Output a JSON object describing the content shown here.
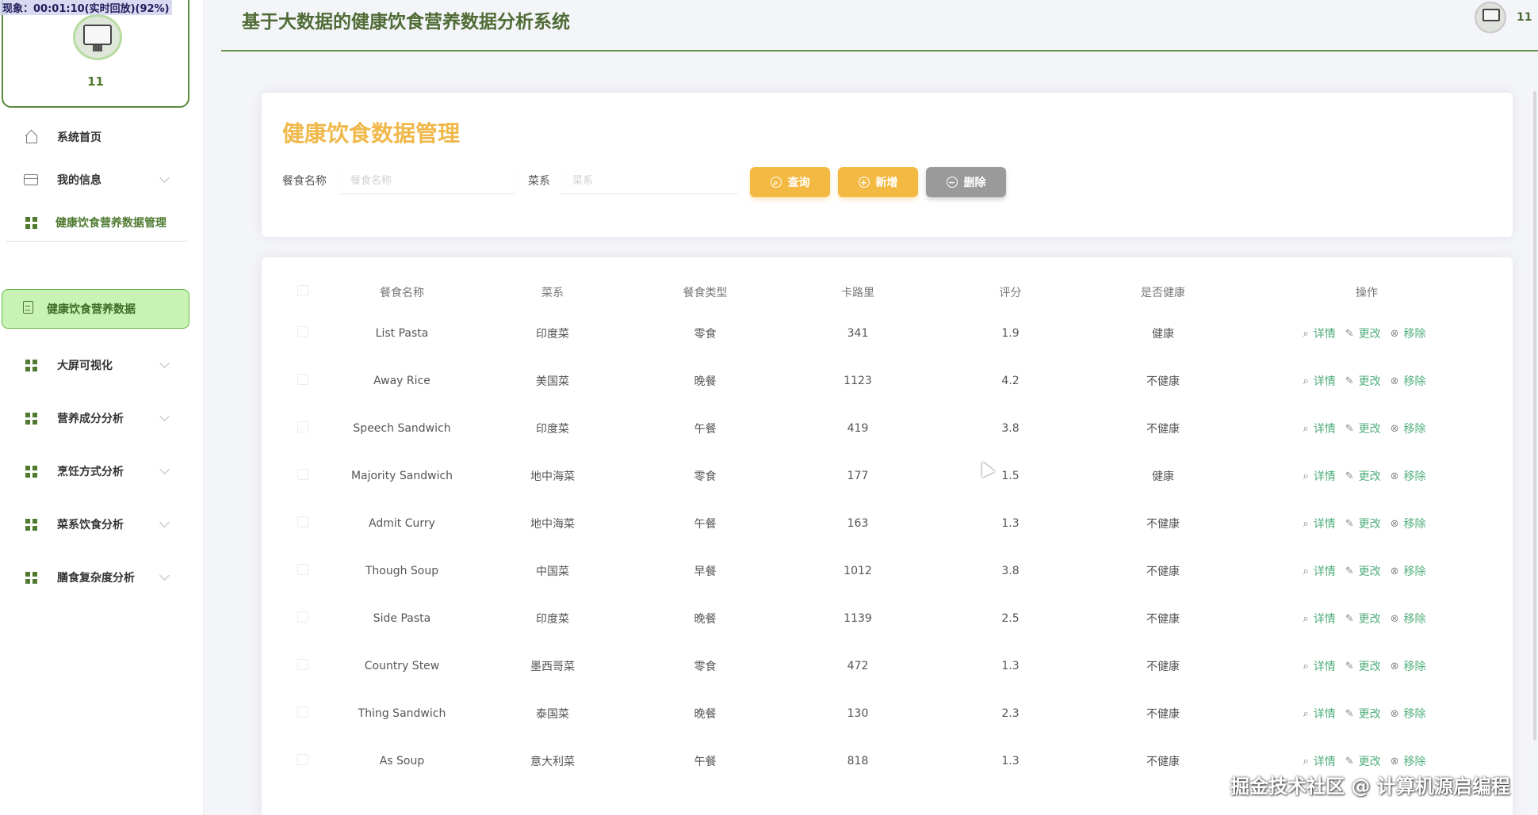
{
  "overlay": "现象：00:01:10(实时回放)(92%)",
  "sidebar": {
    "user_name": "11",
    "menu": [
      {
        "label": "系统首页",
        "icon": "home-icon"
      },
      {
        "label": "我的信息",
        "icon": "card-icon"
      },
      {
        "label": "健康饮食营养数据管理",
        "icon": "grid-icon"
      },
      {
        "label": "健康饮食营养数据",
        "icon": "doc-icon"
      },
      {
        "label": "大屏可视化",
        "icon": "grid-icon"
      },
      {
        "label": "营养成分分析",
        "icon": "grid-icon"
      },
      {
        "label": "烹饪方式分析",
        "icon": "grid-icon"
      },
      {
        "label": "菜系饮食分析",
        "icon": "grid-icon"
      },
      {
        "label": "膳食复杂度分析",
        "icon": "grid-icon"
      }
    ]
  },
  "header": {
    "title": "基于大数据的健康饮食营养数据分析系统",
    "user": "11"
  },
  "search": {
    "title": "健康饮食数据管理",
    "name_label": "餐食名称",
    "name_placeholder": "餐食名称",
    "cuisine_label": "菜系",
    "cuisine_placeholder": "菜系",
    "query": "查询",
    "add": "新增",
    "delete": "删除"
  },
  "table": {
    "headers": [
      "餐食名称",
      "菜系",
      "餐食类型",
      "卡路里",
      "评分",
      "是否健康",
      "操作"
    ],
    "op_detail": "详情",
    "op_edit": "更改",
    "op_remove": "移除",
    "rows": [
      [
        "List Pasta",
        "印度菜",
        "零食",
        "341",
        "1.9",
        "健康"
      ],
      [
        "Away Rice",
        "美国菜",
        "晚餐",
        "1123",
        "4.2",
        "不健康"
      ],
      [
        "Speech Sandwich",
        "印度菜",
        "午餐",
        "419",
        "3.8",
        "不健康"
      ],
      [
        "Majority Sandwich",
        "地中海菜",
        "零食",
        "177",
        "1.5",
        "健康"
      ],
      [
        "Admit Curry",
        "地中海菜",
        "午餐",
        "163",
        "1.3",
        "不健康"
      ],
      [
        "Though Soup",
        "中国菜",
        "早餐",
        "1012",
        "3.8",
        "不健康"
      ],
      [
        "Side Pasta",
        "印度菜",
        "晚餐",
        "1139",
        "2.5",
        "不健康"
      ],
      [
        "Country Stew",
        "墨西哥菜",
        "零食",
        "472",
        "1.3",
        "不健康"
      ],
      [
        "Thing Sandwich",
        "泰国菜",
        "晚餐",
        "130",
        "2.3",
        "不健康"
      ],
      [
        "As Soup",
        "意大利菜",
        "午餐",
        "818",
        "1.3",
        "不健康"
      ]
    ]
  },
  "watermark": "掘金技术社区 @ 计算机源启编程",
  "colors": {
    "accent": "#f4b942",
    "brand": "#4f7a2f",
    "link": "#4fae7b",
    "active_bg": "#c9f3b4"
  }
}
